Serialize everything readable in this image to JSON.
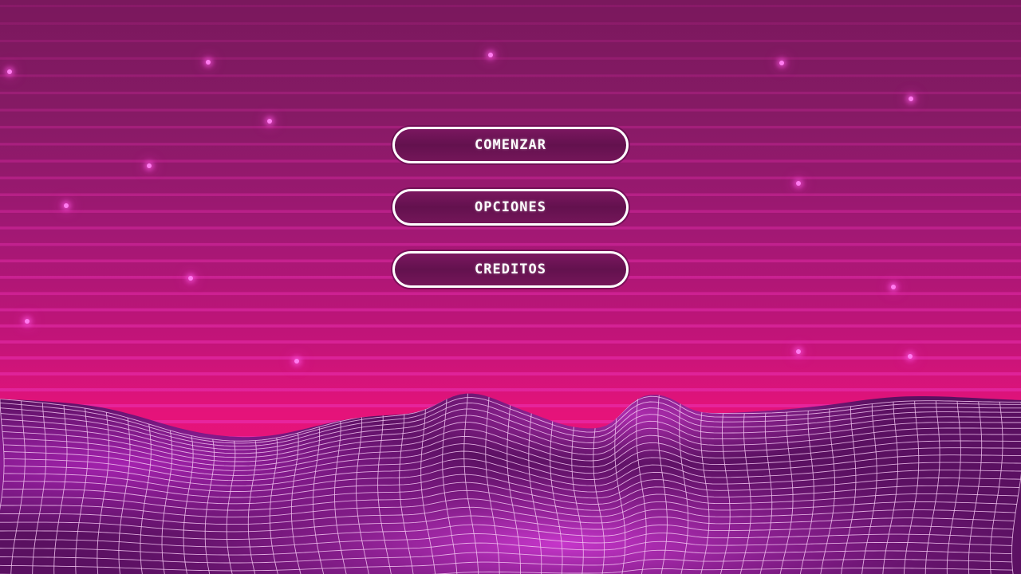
{
  "menu": {
    "start_label": "COMENZAR",
    "options_label": "OPCIONES",
    "credits_label": "CREDITOS"
  },
  "colors": {
    "sky_top": "#7a185d",
    "sky_bottom": "#e5137a",
    "stripe": "#e82fb0",
    "terrain_dark": "#4a0c52",
    "terrain_glow": "#c42ad0",
    "grid_line": "#f2c4f0",
    "button_fill": "#63114e",
    "button_border": "#ffffff"
  },
  "icons": {
    "star": "glowing-star-icon"
  }
}
